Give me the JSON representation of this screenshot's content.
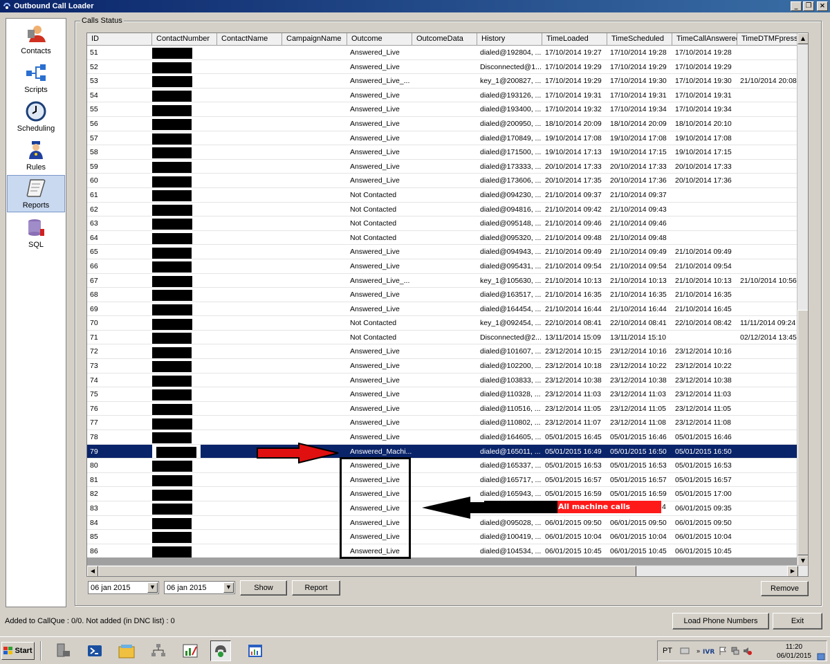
{
  "window": {
    "title": "Outbound Call Loader",
    "controls": {
      "minimize": "_",
      "maximize": "❐",
      "close": "×"
    }
  },
  "nav": {
    "items": [
      {
        "label": "Contacts",
        "icon": "contacts-icon"
      },
      {
        "label": "Scripts",
        "icon": "scripts-icon"
      },
      {
        "label": "Scheduling",
        "icon": "clock-icon"
      },
      {
        "label": "Rules",
        "icon": "rules-icon"
      },
      {
        "label": "Reports",
        "icon": "reports-icon",
        "selected": true
      },
      {
        "label": "SQL",
        "icon": "database-icon"
      }
    ]
  },
  "group": {
    "label": "Calls Status"
  },
  "grid": {
    "columns": [
      "ID",
      "ContactNumber",
      "ContactName",
      "CampaignName",
      "Outcome",
      "OutcomeData",
      "History",
      "TimeLoaded",
      "TimeScheduled",
      "TimeCallAnswered",
      "TimeDTMFpressed"
    ],
    "rows": [
      [
        "51",
        "",
        "",
        "",
        "Answered_Live",
        "",
        "dialed@192804, ...",
        "17/10/2014 19:27",
        "17/10/2014 19:28",
        "17/10/2014 19:28",
        ""
      ],
      [
        "52",
        "",
        "",
        "",
        "Answered_Live",
        "",
        "Disconnected@1...",
        "17/10/2014 19:29",
        "17/10/2014 19:29",
        "17/10/2014 19:29",
        ""
      ],
      [
        "53",
        "",
        "",
        "",
        "Answered_Live_...",
        "",
        "key_1@200827, ...",
        "17/10/2014 19:29",
        "17/10/2014 19:30",
        "17/10/2014 19:30",
        "21/10/2014 20:08"
      ],
      [
        "54",
        "",
        "",
        "",
        "Answered_Live",
        "",
        "dialed@193126, ...",
        "17/10/2014 19:31",
        "17/10/2014 19:31",
        "17/10/2014 19:31",
        ""
      ],
      [
        "55",
        "",
        "",
        "",
        "Answered_Live",
        "",
        "dialed@193400, ...",
        "17/10/2014 19:32",
        "17/10/2014 19:34",
        "17/10/2014 19:34",
        ""
      ],
      [
        "56",
        "",
        "",
        "",
        "Answered_Live",
        "",
        "dialed@200950, ...",
        "18/10/2014 20:09",
        "18/10/2014 20:09",
        "18/10/2014 20:10",
        ""
      ],
      [
        "57",
        "",
        "",
        "",
        "Answered_Live",
        "",
        "dialed@170849, ...",
        "19/10/2014 17:08",
        "19/10/2014 17:08",
        "19/10/2014 17:08",
        ""
      ],
      [
        "58",
        "",
        "",
        "",
        "Answered_Live",
        "",
        "dialed@171500, ...",
        "19/10/2014 17:13",
        "19/10/2014 17:15",
        "19/10/2014 17:15",
        ""
      ],
      [
        "59",
        "",
        "",
        "",
        "Answered_Live",
        "",
        "dialed@173333, ...",
        "20/10/2014 17:33",
        "20/10/2014 17:33",
        "20/10/2014 17:33",
        ""
      ],
      [
        "60",
        "",
        "",
        "",
        "Answered_Live",
        "",
        "dialed@173606, ...",
        "20/10/2014 17:35",
        "20/10/2014 17:36",
        "20/10/2014 17:36",
        ""
      ],
      [
        "61",
        "",
        "",
        "",
        "Not Contacted",
        "",
        "dialed@094230, ...",
        "21/10/2014 09:37",
        "21/10/2014 09:37",
        "",
        ""
      ],
      [
        "62",
        "",
        "",
        "",
        "Not Contacted",
        "",
        "dialed@094816, ...",
        "21/10/2014 09:42",
        "21/10/2014 09:43",
        "",
        ""
      ],
      [
        "63",
        "",
        "",
        "",
        "Not Contacted",
        "",
        "dialed@095148, ...",
        "21/10/2014 09:46",
        "21/10/2014 09:46",
        "",
        ""
      ],
      [
        "64",
        "",
        "",
        "",
        "Not Contacted",
        "",
        "dialed@095320, ...",
        "21/10/2014 09:48",
        "21/10/2014 09:48",
        "",
        ""
      ],
      [
        "65",
        "",
        "",
        "",
        "Answered_Live",
        "",
        "dialed@094943, ...",
        "21/10/2014 09:49",
        "21/10/2014 09:49",
        "21/10/2014 09:49",
        ""
      ],
      [
        "66",
        "",
        "",
        "",
        "Answered_Live",
        "",
        "dialed@095431, ...",
        "21/10/2014 09:54",
        "21/10/2014 09:54",
        "21/10/2014 09:54",
        ""
      ],
      [
        "67",
        "",
        "",
        "",
        "Answered_Live_...",
        "",
        "key_1@105630, ...",
        "21/10/2014 10:13",
        "21/10/2014 10:13",
        "21/10/2014 10:13",
        "21/10/2014 10:56"
      ],
      [
        "68",
        "",
        "",
        "",
        "Answered_Live",
        "",
        "dialed@163517, ...",
        "21/10/2014 16:35",
        "21/10/2014 16:35",
        "21/10/2014 16:35",
        ""
      ],
      [
        "69",
        "",
        "",
        "",
        "Answered_Live",
        "",
        "dialed@164454, ...",
        "21/10/2014 16:44",
        "21/10/2014 16:44",
        "21/10/2014 16:45",
        ""
      ],
      [
        "70",
        "",
        "",
        "",
        "Not Contacted",
        "",
        "key_1@092454, ...",
        "22/10/2014 08:41",
        "22/10/2014 08:41",
        "22/10/2014 08:42",
        "11/11/2014 09:24"
      ],
      [
        "71",
        "",
        "",
        "",
        "Not Contacted",
        "",
        "Disconnected@2...",
        "13/11/2014 15:09",
        "13/11/2014 15:10",
        "",
        "02/12/2014 13:45"
      ],
      [
        "72",
        "",
        "",
        "",
        "Answered_Live",
        "",
        "dialed@101607, ...",
        "23/12/2014 10:15",
        "23/12/2014 10:16",
        "23/12/2014 10:16",
        ""
      ],
      [
        "73",
        "",
        "",
        "",
        "Answered_Live",
        "",
        "dialed@102200, ...",
        "23/12/2014 10:18",
        "23/12/2014 10:22",
        "23/12/2014 10:22",
        ""
      ],
      [
        "74",
        "",
        "",
        "",
        "Answered_Live",
        "",
        "dialed@103833, ...",
        "23/12/2014 10:38",
        "23/12/2014 10:38",
        "23/12/2014 10:38",
        ""
      ],
      [
        "75",
        "",
        "",
        "",
        "Answered_Live",
        "",
        "dialed@110328, ...",
        "23/12/2014 11:03",
        "23/12/2014 11:03",
        "23/12/2014 11:03",
        ""
      ],
      [
        "76",
        "",
        "",
        "",
        "Answered_Live",
        "",
        "dialed@110516, ...",
        "23/12/2014 11:05",
        "23/12/2014 11:05",
        "23/12/2014 11:05",
        ""
      ],
      [
        "77",
        "",
        "",
        "",
        "Answered_Live",
        "",
        "dialed@110802, ...",
        "23/12/2014 11:07",
        "23/12/2014 11:08",
        "23/12/2014 11:08",
        ""
      ],
      [
        "78",
        "",
        "",
        "",
        "Answered_Live",
        "",
        "dialed@164605, ...",
        "05/01/2015 16:45",
        "05/01/2015 16:46",
        "05/01/2015 16:46",
        ""
      ],
      [
        "79",
        "",
        "",
        "",
        "Answered_Machi...",
        "",
        "dialed@165011, ...",
        "05/01/2015 16:49",
        "05/01/2015 16:50",
        "05/01/2015 16:50",
        ""
      ],
      [
        "80",
        "",
        "",
        "",
        "Answered_Live",
        "",
        "dialed@165337, ...",
        "05/01/2015 16:53",
        "05/01/2015 16:53",
        "05/01/2015 16:53",
        ""
      ],
      [
        "81",
        "",
        "",
        "",
        "Answered_Live",
        "",
        "dialed@165717, ...",
        "05/01/2015 16:57",
        "05/01/2015 16:57",
        "05/01/2015 16:57",
        ""
      ],
      [
        "82",
        "",
        "",
        "",
        "Answered_Live",
        "",
        "dialed@165943, ...",
        "05/01/2015 16:59",
        "05/01/2015 16:59",
        "05/01/2015 17:00",
        ""
      ],
      [
        "83",
        "",
        "",
        "",
        "Answered_Live",
        "",
        "",
        "06/0",
        "",
        "06/01/2015 09:35",
        ""
      ],
      [
        "84",
        "",
        "",
        "",
        "Answered_Live",
        "",
        "dialed@095028, ...",
        "06/01/2015 09:50",
        "06/01/2015 09:50",
        "06/01/2015 09:50",
        ""
      ],
      [
        "85",
        "",
        "",
        "",
        "Answered_Live",
        "",
        "dialed@100419, ...",
        "06/01/2015 10:04",
        "06/01/2015 10:04",
        "06/01/2015 10:04",
        ""
      ],
      [
        "86",
        "",
        "",
        "",
        "Answered_Live",
        "",
        "dialed@104534, ...",
        "06/01/2015 10:45",
        "06/01/2015 10:45",
        "06/01/2015 10:45",
        ""
      ]
    ],
    "selected_row_id": "79"
  },
  "controls": {
    "date_from": "06 jan 2015",
    "date_to": "06 jan 2015",
    "show_label": "Show",
    "report_label": "Report",
    "remove_label": "Remove",
    "load_label": "Load Phone Numbers",
    "exit_label": "Exit"
  },
  "status": {
    "text": "Added to CallQue : 0/0. Not added (in DNC list) : 0"
  },
  "annotation": {
    "label": "All machine calls",
    "partial_text": "4",
    "color": "#ff1a1a"
  },
  "taskbar": {
    "start_label": "Start",
    "language": "PT",
    "time": "11:20",
    "date": "06/01/2015"
  }
}
